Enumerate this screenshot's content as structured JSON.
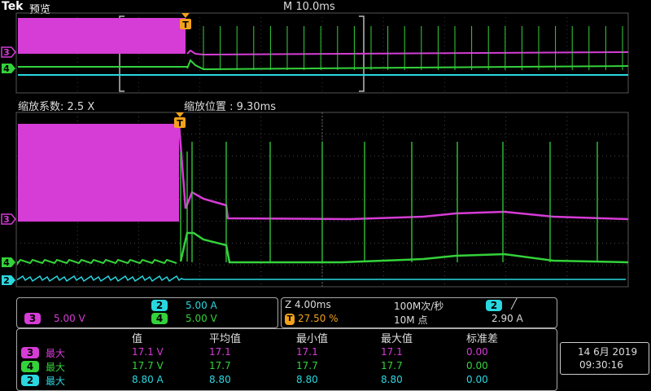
{
  "header": {
    "brand": "Tek",
    "mode": "预览",
    "timebase": "M 10.0ms"
  },
  "zoom": {
    "factor_label": "缩放系数: 2.5 X",
    "position_label": "缩放位置 :  9.30ms"
  },
  "channel_settings": {
    "ch3": {
      "num": "3",
      "scale": "5.00 V"
    },
    "ch2": {
      "num": "2",
      "scale": "5.00 A"
    },
    "ch4": {
      "num": "4",
      "scale": "5.00 V"
    }
  },
  "acquisition": {
    "zoom_time": "Z 4.00ms",
    "trigger_pos": "27.50 %",
    "sample_rate": "100M次/秒",
    "record_length": "10M 点",
    "trigger_ch": "2",
    "trigger_slope": "╱",
    "trigger_level": "2.90 A"
  },
  "measurements": {
    "columns": [
      "值",
      "平均值",
      "最小值",
      "最大值",
      "标准差"
    ],
    "rows": [
      {
        "ch": "3",
        "type": "最大",
        "value": "17.1 V",
        "mean": "17.1",
        "min": "17.1",
        "max": "17.1",
        "std": "0.00",
        "color": "#d63cd6"
      },
      {
        "ch": "4",
        "type": "最大",
        "value": "17.7 V",
        "mean": "17.7",
        "min": "17.7",
        "max": "17.7",
        "std": "0.00",
        "color": "#34d23a"
      },
      {
        "ch": "2",
        "type": "最大",
        "value": "8.80 A",
        "mean": "8.80",
        "min": "8.80",
        "max": "8.80",
        "std": "0.00",
        "color": "#2ad7e0"
      }
    ]
  },
  "datetime": {
    "date": "14 6月 2019",
    "time": "09:30:16"
  },
  "markers": {
    "ch3": "3",
    "ch4": "4",
    "ch2": "2",
    "trigger": "T"
  },
  "colors": {
    "ch3": "#d63cd6",
    "ch4": "#34d23a",
    "ch2": "#2ad7e0",
    "trigger": "#f2a21a"
  }
}
